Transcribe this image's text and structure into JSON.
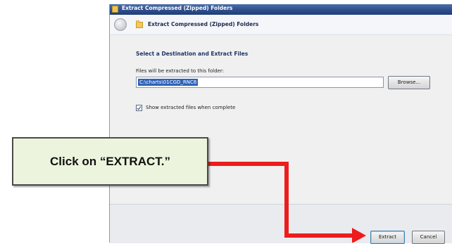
{
  "window": {
    "title": "Extract Compressed (Zipped) Folders",
    "icon": "zip-folder-icon"
  },
  "nav": {
    "back_icon": "back-arrow-icon",
    "folder_icon": "zip-folder-icon",
    "title": "Extract Compressed (Zipped) Folders"
  },
  "content": {
    "heading": "Select a Destination and Extract Files",
    "destination_label": "Files will be extracted to this folder:",
    "destination_value": "C:\\charts\\01CGD_RNC6",
    "browse_label": "Browse...",
    "show_files_checked": true,
    "show_files_label": "Show extracted files when complete"
  },
  "footer": {
    "extract_label": "Extract",
    "cancel_label": "Cancel"
  },
  "annotation": {
    "callout_text": "Click on “EXTRACT.”",
    "arrow_color": "#ee1c1c",
    "callout_bg": "#edf4de"
  }
}
